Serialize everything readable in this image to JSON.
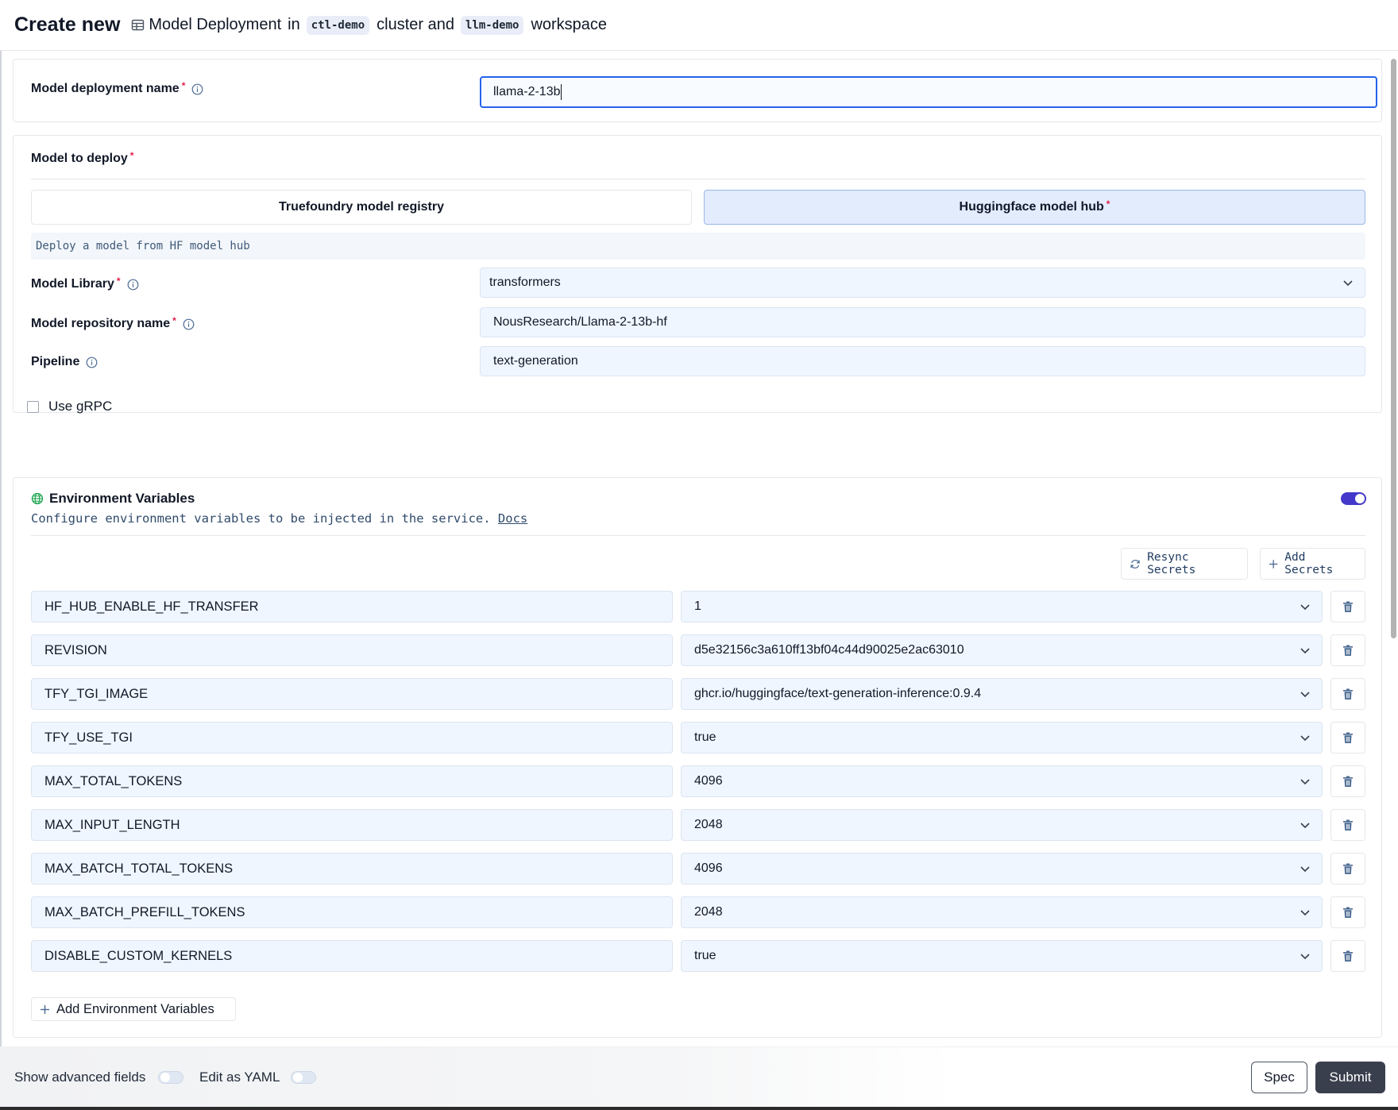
{
  "header": {
    "title": "Create new",
    "resource": "Model Deployment",
    "in_text": "in",
    "cluster": "ctl-demo",
    "cluster_text": "cluster and",
    "workspace": "llm-demo",
    "workspace_text": "workspace"
  },
  "deployment_name": {
    "label": "Model deployment name",
    "value": "llama-2-13b"
  },
  "model_to_deploy": {
    "label": "Model to deploy",
    "options": [
      "Truefoundry model registry",
      "Huggingface model hub"
    ],
    "selected": "Huggingface model hub",
    "hint": "Deploy a model from HF model hub",
    "library_label": "Model Library",
    "library_value": "transformers",
    "repo_label": "Model repository name",
    "repo_value": "NousResearch/Llama-2-13b-hf",
    "pipeline_label": "Pipeline",
    "pipeline_value": "text-generation"
  },
  "grpc": {
    "label": "Use gRPC",
    "checked": false
  },
  "env": {
    "title": "Environment Variables",
    "description": "Configure environment variables to be injected in the service.",
    "docs_link": "Docs",
    "enabled": true,
    "resync_label": "Resync Secrets",
    "add_secrets_label": "Add Secrets",
    "add_label": "Add Environment Variables",
    "variables": [
      {
        "key": "HF_HUB_ENABLE_HF_TRANSFER",
        "value": "1"
      },
      {
        "key": "REVISION",
        "value": "d5e32156c3a610ff13bf04c44d90025e2ac63010"
      },
      {
        "key": "TFY_TGI_IMAGE",
        "value": "ghcr.io/huggingface/text-generation-inference:0.9.4"
      },
      {
        "key": "TFY_USE_TGI",
        "value": "true"
      },
      {
        "key": "MAX_TOTAL_TOKENS",
        "value": "4096"
      },
      {
        "key": "MAX_INPUT_LENGTH",
        "value": "2048"
      },
      {
        "key": "MAX_BATCH_TOTAL_TOKENS",
        "value": "4096"
      },
      {
        "key": "MAX_BATCH_PREFILL_TOKENS",
        "value": "2048"
      },
      {
        "key": "DISABLE_CUSTOM_KERNELS",
        "value": "true"
      }
    ]
  },
  "footer": {
    "advanced_label": "Show advanced fields",
    "yaml_label": "Edit as YAML",
    "spec_label": "Spec",
    "submit_label": "Submit"
  },
  "colors": {
    "accent": "#2563eb",
    "toggle_on": "#4338ca",
    "required": "#e11d48",
    "submit": "#3a3f4d"
  }
}
